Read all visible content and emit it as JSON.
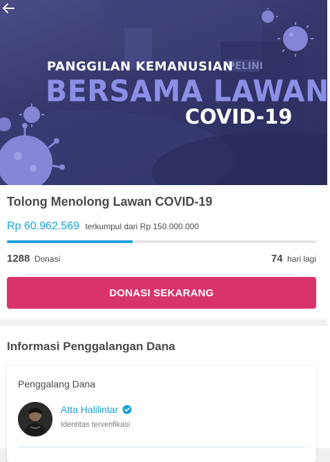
{
  "banner": {
    "line1": "PANGGILAN KEMANUSIAN",
    "line2": "BERSAMA LAWAN",
    "line3": "COVID-19",
    "sign_text": "PELINI"
  },
  "campaign": {
    "title": "Tolong Menolong Lawan COVID-19",
    "amount": "Rp 60.962.569",
    "amount_suffix": "terkumpul dari Rp 150.000.000",
    "progress_fraction": 0.406,
    "donors_count": "1288",
    "donors_label": "Donasi",
    "days_count": "74",
    "days_label": "hari lagi",
    "donate_label": "DONASI SEKARANG"
  },
  "fundraiser_info": {
    "section_title": "Informasi Penggalangan Dana",
    "card_label": "Penggalang Dana",
    "name": "Atta Halilintar",
    "verified_label": "Identitas terverifikasi"
  },
  "colors": {
    "accent": "#1aa2d6",
    "donate_button": "#d8336a",
    "banner_bg": "#35376b",
    "banner_highlight": "#8c8fe6"
  },
  "icons": {
    "back": "arrow-left-icon",
    "verified": "verified-check-icon",
    "virus": "virus-icon"
  }
}
